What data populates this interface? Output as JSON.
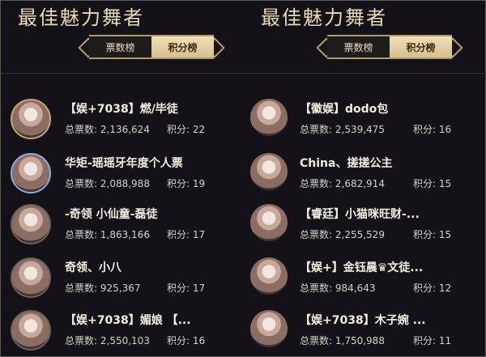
{
  "panels": [
    {
      "title": "最佳魅力舞者",
      "tabs": [
        "票数榜",
        "积分榜"
      ],
      "active_tab": "积分榜",
      "entries": [
        {
          "name": "【娱+7038】燃/毕徒",
          "votes_label": "总票数:",
          "votes": "2,136,624",
          "score_label": "积分:",
          "score": "22"
        },
        {
          "name": "华矩-瑶瑶牙年度个人票",
          "votes_label": "总票数:",
          "votes": "2,088,988",
          "score_label": "积分:",
          "score": "19"
        },
        {
          "name": "-奇领 小仙童-磊徒",
          "votes_label": "总票数:",
          "votes": "1,863,166",
          "score_label": "积分:",
          "score": "17"
        },
        {
          "name": "奇领、小八",
          "votes_label": "总票数:",
          "votes": "925,367",
          "score_label": "积分:",
          "score": "17"
        },
        {
          "name": "【娱+7038】媚娘 【...",
          "votes_label": "总票数:",
          "votes": "2,550,103",
          "score_label": "积分:",
          "score": "16"
        }
      ]
    },
    {
      "title": "最佳魅力舞者",
      "tabs": [
        "票数榜",
        "积分榜"
      ],
      "active_tab": "积分榜",
      "entries": [
        {
          "name": "【徽娱】dodo包",
          "votes_label": "总票数:",
          "votes": "2,539,475",
          "score_label": "积分:",
          "score": "16"
        },
        {
          "name": "China、搓搓公主",
          "votes_label": "总票数:",
          "votes": "2,682,914",
          "score_label": "积分:",
          "score": "15"
        },
        {
          "name": "【睿廷】小猫咪旺财-...",
          "votes_label": "总票数:",
          "votes": "2,255,529",
          "score_label": "积分:",
          "score": "15"
        },
        {
          "name": "【娱+】金钰晨♛文徒...",
          "votes_label": "总票数:",
          "votes": "984,643",
          "score_label": "积分:",
          "score": "12"
        },
        {
          "name": "【娱+7038】木子婉 ...",
          "votes_label": "总票数:",
          "votes": "1,750,988",
          "score_label": "积分:",
          "score": "11"
        }
      ]
    }
  ]
}
